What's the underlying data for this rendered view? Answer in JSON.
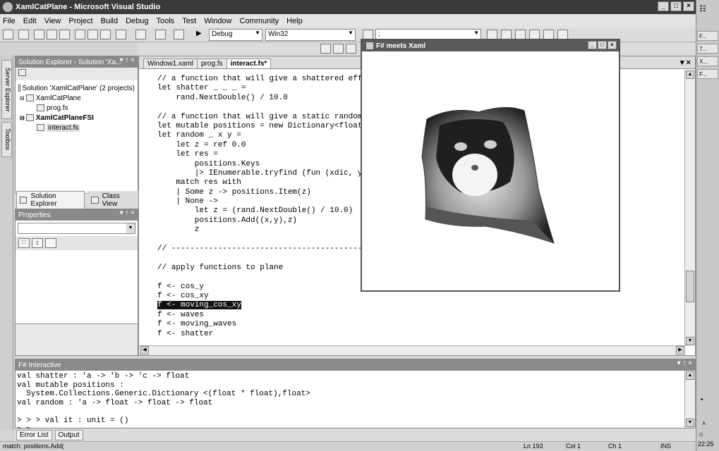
{
  "window": {
    "title": "XamlCatPlane - Microsoft Visual Studio",
    "min": "_",
    "max": "□",
    "close": "×"
  },
  "menu": [
    "File",
    "Edit",
    "View",
    "Project",
    "Build",
    "Debug",
    "Tools",
    "Test",
    "Window",
    "Community",
    "Help"
  ],
  "toolbar": {
    "config": "Debug",
    "platform": "Win32",
    "find": ";"
  },
  "left_rail": {
    "server_explorer": "Server Explorer",
    "toolbox": "Toolbox"
  },
  "solution_explorer": {
    "title": "Solution Explorer - Solution 'Xa...",
    "controls": "▾ ↑ ×",
    "items": [
      {
        "label": "Solution 'XamlCatPlane' (2 projects)",
        "indent": 0,
        "bold": false
      },
      {
        "label": "XamlCatPlane",
        "indent": 1,
        "bold": false
      },
      {
        "label": "prog.fs",
        "indent": 2,
        "bold": false
      },
      {
        "label": "XamlCatPlaneFSI",
        "indent": 1,
        "bold": true
      },
      {
        "label": "interact.fs",
        "indent": 2,
        "bold": false
      }
    ],
    "tabs": [
      "Solution Explorer",
      "Class View"
    ]
  },
  "properties": {
    "title": "Properties",
    "controls": "▾ ↑ ×",
    "tool_a": "∷",
    "tool_b": "↕"
  },
  "editor": {
    "tabs": [
      {
        "label": "Window1.xaml",
        "active": false
      },
      {
        "label": "prog.fs",
        "active": false
      },
      {
        "label": "interact.fs*",
        "active": true
      }
    ],
    "controls": "▾ ×",
    "selected_line": 32,
    "lines": [
      "// a function that will give a shattered effe",
      "let shatter _ _ _ =",
      "    rand.NextDouble() / 10.0",
      "",
      "// a function that will give a static random",
      "let mutable positions = new Dictionary<float",
      "let random _ x y =",
      "    let z = ref 0.0",
      "    let res =",
      "        positions.Keys",
      "        |> IEnumerable.tryfind (fun (xdic, yd",
      "    match res with",
      "    | Some z -> positions.Item(z)",
      "    | None ->",
      "        let z = (rand.NextDouble() / 10.0)",
      "        positions.Add((x,y),z)",
      "        z",
      "",
      "// --------------------------------------------",
      "",
      "// apply functions to plane",
      "",
      "f <- cos_y",
      "f <- cos_xy",
      "f <- moving_cos_xy",
      "f <- waves",
      "f <- moving_waves",
      "f <- shatter"
    ]
  },
  "fsharp_window": {
    "title": "F# meets Xaml",
    "min": "_",
    "max": "□",
    "close": "×"
  },
  "interactive": {
    "title": "F# Interactive",
    "controls": "▾ ↑ ×",
    "lines": [
      "val shatter : 'a -> 'b -> 'c -> float",
      "val mutable positions :",
      "  System.Collections.Generic.Dictionary <(float * float),float>",
      "val random : 'a -> float -> float -> float",
      "",
      "> > > val it : unit = ()",
      "> >"
    ]
  },
  "bottom_tabs": [
    "Error List",
    "Output"
  ],
  "status": {
    "message": "match: positions.Add(",
    "ln": "Ln 193",
    "col": "Col 1",
    "ch": "Ch 1",
    "ins": "INS"
  },
  "taskbar": {
    "items": [
      "F...",
      "7...",
      "X...",
      "F..."
    ],
    "clock": "22:25"
  }
}
